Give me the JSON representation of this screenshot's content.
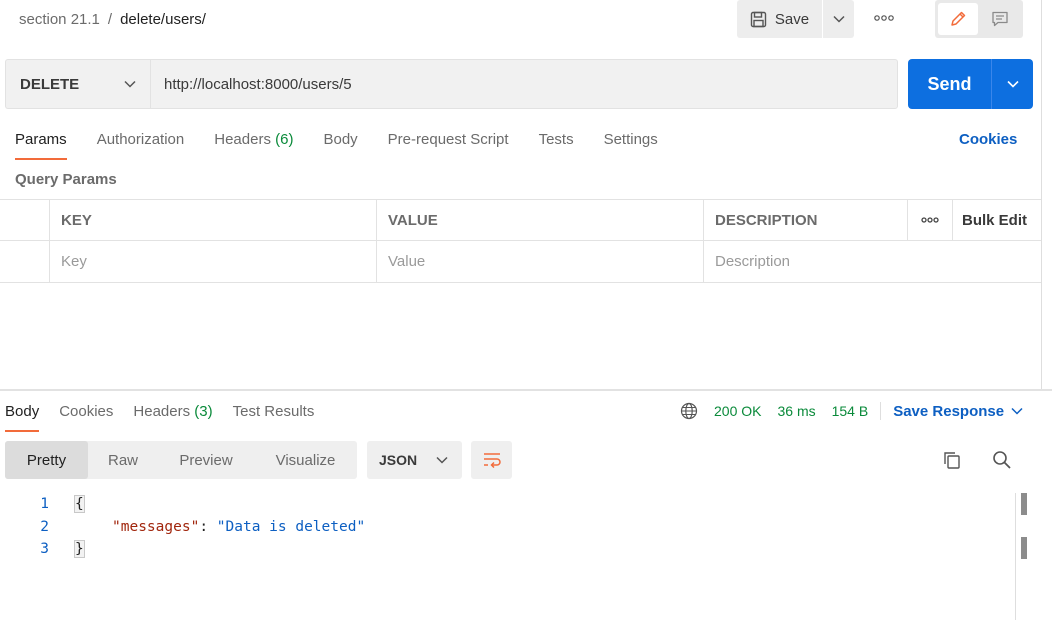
{
  "breadcrumb": {
    "parent": "section 21.1",
    "separator": "/",
    "current": "delete/users/"
  },
  "toolbar": {
    "save_label": "Save"
  },
  "request": {
    "method": "DELETE",
    "url": "http://localhost:8000/users/5",
    "send_label": "Send"
  },
  "request_tabs": [
    {
      "label": "Params",
      "count": ""
    },
    {
      "label": "Authorization",
      "count": ""
    },
    {
      "label": "Headers",
      "count": "(6)"
    },
    {
      "label": "Body",
      "count": ""
    },
    {
      "label": "Pre-request Script",
      "count": ""
    },
    {
      "label": "Tests",
      "count": ""
    },
    {
      "label": "Settings",
      "count": ""
    }
  ],
  "cookies_link": "Cookies",
  "query_params": {
    "title": "Query Params",
    "headers": {
      "key": "KEY",
      "value": "VALUE",
      "description": "DESCRIPTION",
      "bulk_edit": "Bulk Edit"
    },
    "placeholders": {
      "key": "Key",
      "value": "Value",
      "description": "Description"
    }
  },
  "response_tabs": [
    {
      "label": "Body",
      "count": ""
    },
    {
      "label": "Cookies",
      "count": ""
    },
    {
      "label": "Headers",
      "count": "(3)"
    },
    {
      "label": "Test Results",
      "count": ""
    }
  ],
  "response_meta": {
    "status": "200 OK",
    "time": "36 ms",
    "size": "154 B",
    "save_response": "Save Response"
  },
  "format_options": [
    "Pretty",
    "Raw",
    "Preview",
    "Visualize"
  ],
  "language": "JSON",
  "code": {
    "lines": [
      "1",
      "2",
      "3"
    ],
    "open_brace": "{",
    "key": "\"messages\"",
    "colon": ": ",
    "value": "\"Data is deleted\"",
    "close_brace": "}"
  },
  "colors": {
    "accent": "#f26b3a",
    "primary": "#0d6fe0",
    "link": "#0d5fc2",
    "status_ok": "#0a8a3a"
  }
}
